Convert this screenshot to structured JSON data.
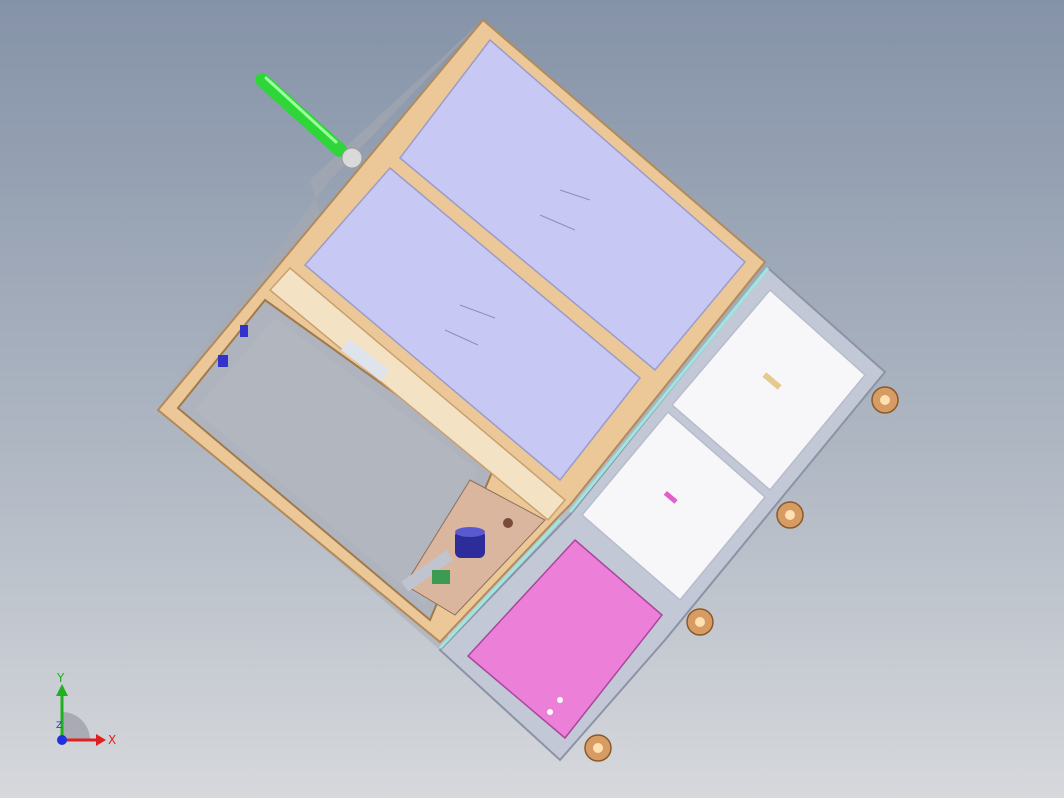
{
  "colors": {
    "background_top": "#8593a8",
    "background_bottom": "#d6d8dc",
    "frame_wood": "#ecc898",
    "frame_wood_dark": "#c9a06e",
    "glass_panel": "#c8c8f4",
    "panel_white": "#f7f7fa",
    "panel_magenta": "#ec7fd8",
    "rail_gray": "#c3c8d6",
    "handle_green": "#2fd63a",
    "caster_bronze": "#d79c64",
    "axis_x": "#e02020",
    "axis_y": "#20b020",
    "axis_z": "#2030e0"
  },
  "view": {
    "model_name": "",
    "icons": [
      "cad-assembly-model",
      "axis-triad-icon"
    ]
  },
  "axes": {
    "x_label": "X",
    "y_label": "Y",
    "z_label": "Z"
  }
}
